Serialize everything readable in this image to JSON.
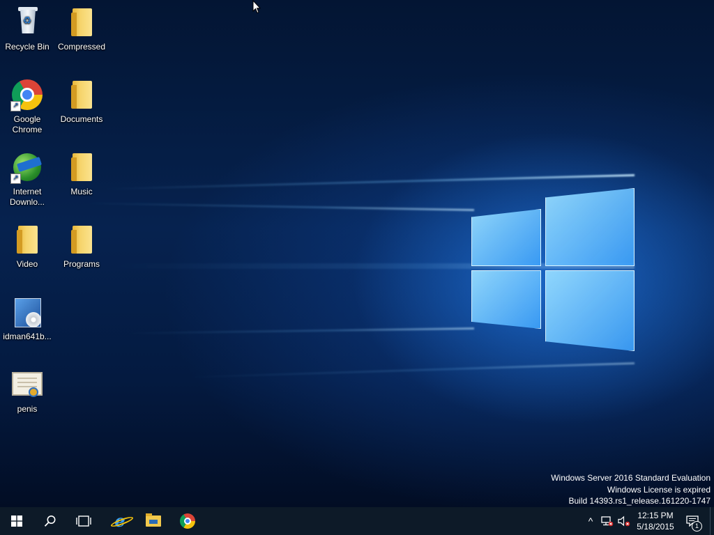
{
  "desktop": {
    "icons": [
      {
        "label": "Recycle Bin",
        "icon": "recycle-bin-icon"
      },
      {
        "label": "Compressed",
        "icon": "folder-icon"
      },
      {
        "label": "Google Chrome",
        "icon": "chrome-icon",
        "shortcut": true
      },
      {
        "label": "Documents",
        "icon": "folder-icon"
      },
      {
        "label": "Internet Downlo...",
        "icon": "internet-download-manager-icon",
        "shortcut": true
      },
      {
        "label": "Music",
        "icon": "folder-icon"
      },
      {
        "label": "Video",
        "icon": "folder-icon"
      },
      {
        "label": "Programs",
        "icon": "folder-icon"
      },
      {
        "label": "idman641b...",
        "icon": "installer-icon"
      },
      {
        "label": "penis",
        "icon": "certificate-icon"
      }
    ]
  },
  "watermark": {
    "line1": "Windows Server 2016 Standard Evaluation",
    "line2": "Windows License is expired",
    "line3": "Build 14393.rs1_release.161220-1747"
  },
  "taskbar": {
    "start_icon": "windows-start-icon",
    "search_icon": "search-icon",
    "task_view_icon": "task-view-icon",
    "pinned": [
      {
        "name": "Internet Explorer",
        "icon": "internet-explorer-icon"
      },
      {
        "name": "File Explorer",
        "icon": "file-explorer-icon"
      },
      {
        "name": "Google Chrome",
        "icon": "chrome-icon"
      }
    ],
    "tray": {
      "chevron": "^",
      "time": "12:15 PM",
      "date": "5/18/2015",
      "notification_count": "1"
    }
  },
  "colors": {
    "taskbar_bg": "#0d1a28",
    "accent": "#76b9ed",
    "desktop_bg": "#06224f"
  }
}
